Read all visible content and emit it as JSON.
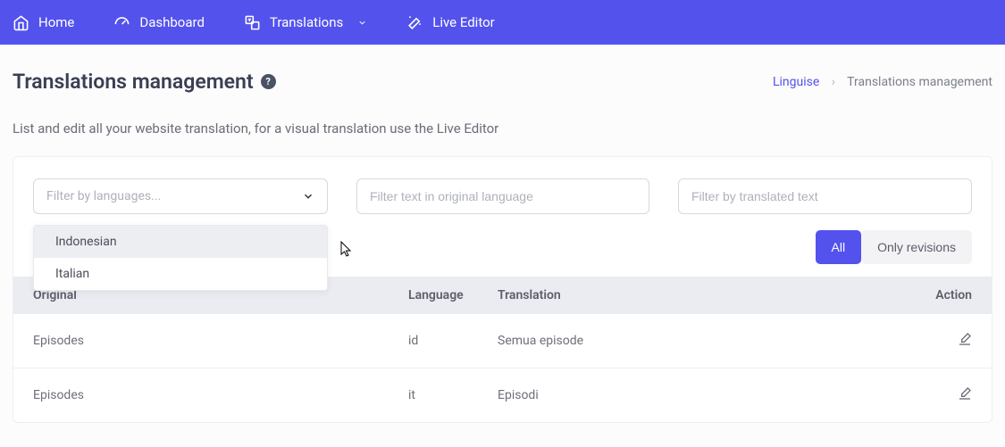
{
  "nav": {
    "home": "Home",
    "dashboard": "Dashboard",
    "translations": "Translations",
    "live": "Live Editor"
  },
  "page": {
    "title": "Translations management",
    "intro": "List and edit all your website translation, for a visual translation use the Live Editor"
  },
  "crumb": {
    "root": "Linguise",
    "here": "Translations management"
  },
  "filters": {
    "lang_placeholder": "Filter by languages...",
    "orig_placeholder": "Filter text in original language",
    "trans_placeholder": "Filter by translated text"
  },
  "dropdown": {
    "opt1": "Indonesian",
    "opt2": "Italian"
  },
  "seg": {
    "all": "All",
    "rev": "Only revisions"
  },
  "cols": {
    "orig": "Original",
    "lang": "Language",
    "trans": "Translation",
    "act": "Action"
  },
  "rows": [
    {
      "orig": "Episodes",
      "lang": "id",
      "trans": "Semua episode"
    },
    {
      "orig": "Episodes",
      "lang": "it",
      "trans": "Episodi"
    }
  ]
}
